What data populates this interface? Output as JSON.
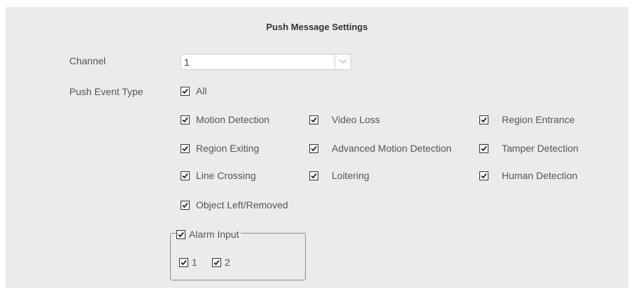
{
  "title": "Push Message Settings",
  "channel": {
    "label": "Channel",
    "value": "1",
    "arrow_icon": "chevron-down-icon"
  },
  "push_event": {
    "label": "Push Event Type",
    "all": {
      "label": "All",
      "checked": true
    },
    "events": [
      {
        "label": "Motion Detection",
        "checked": true
      },
      {
        "label": "Video Loss",
        "checked": true
      },
      {
        "label": "Region Entrance",
        "checked": true
      },
      {
        "label": "Region Exiting",
        "checked": true
      },
      {
        "label": "Advanced Motion Detection",
        "checked": true
      },
      {
        "label": "Tamper Detection",
        "checked": true
      },
      {
        "label": "Line Crossing",
        "checked": true
      },
      {
        "label": "Loitering",
        "checked": true
      },
      {
        "label": "Human Detection",
        "checked": true
      },
      {
        "label": "Object Left/Removed",
        "checked": true
      }
    ]
  },
  "alarm_input": {
    "label": "Alarm Input",
    "checked": true,
    "items": [
      {
        "label": "1",
        "checked": true
      },
      {
        "label": "2",
        "checked": true
      }
    ]
  },
  "colors": {
    "panel_bg": "#ebebeb",
    "text": "#555555",
    "title": "#333333"
  }
}
